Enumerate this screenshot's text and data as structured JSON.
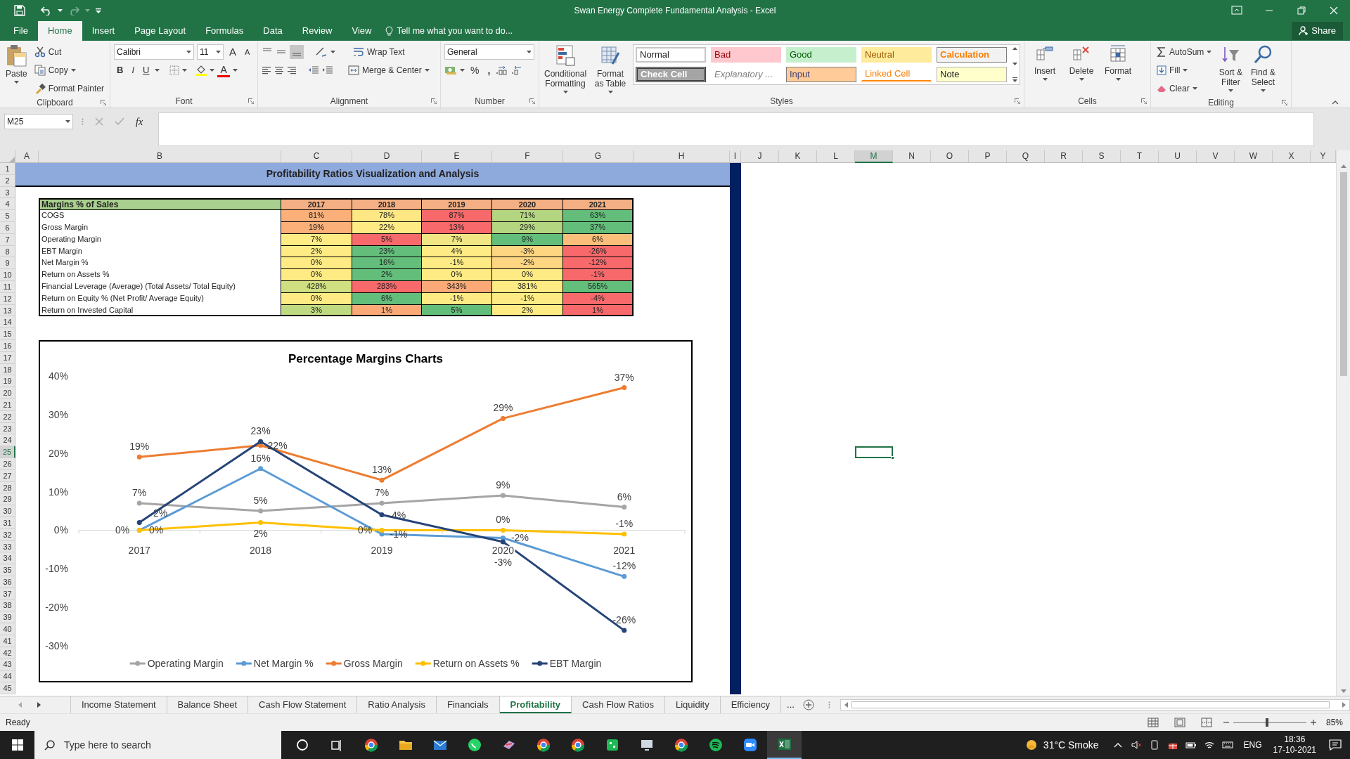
{
  "window": {
    "title": "Swan Energy Complete Fundamental Analysis - Excel"
  },
  "menu_tabs": [
    {
      "label": "File",
      "selected": false
    },
    {
      "label": "Home",
      "selected": true
    },
    {
      "label": "Insert",
      "selected": false
    },
    {
      "label": "Page Layout",
      "selected": false
    },
    {
      "label": "Formulas",
      "selected": false
    },
    {
      "label": "Data",
      "selected": false
    },
    {
      "label": "Review",
      "selected": false
    },
    {
      "label": "View",
      "selected": false
    }
  ],
  "tell_me": "Tell me what you want to do...",
  "share": "Share",
  "ribbon": {
    "clipboard": {
      "label": "Clipboard",
      "paste": "Paste",
      "cut": "Cut",
      "copy": "Copy",
      "format_painter": "Format Painter"
    },
    "font": {
      "label": "Font",
      "font_name": "Calibri",
      "font_size": "11",
      "grow_font": "A",
      "shrink_font": "A",
      "bold": "B",
      "italic": "I",
      "underline": "U",
      "font_color": "A"
    },
    "alignment": {
      "label": "Alignment",
      "wrap_text": "Wrap Text",
      "merge_center": "Merge & Center"
    },
    "number": {
      "label": "Number",
      "format": "General",
      "percent": "%",
      "comma": ","
    },
    "styles": {
      "label": "Styles",
      "conditional_formatting": "Conditional Formatting",
      "format_as_table": "Format as Table",
      "cell_styles": [
        {
          "label": "Normal",
          "kind": "normal"
        },
        {
          "label": "Bad",
          "kind": "bad"
        },
        {
          "label": "Good",
          "kind": "good"
        },
        {
          "label": "Neutral",
          "kind": "neutral"
        },
        {
          "label": "Calculation",
          "kind": "calculation"
        },
        {
          "label": "Check Cell",
          "kind": "check"
        },
        {
          "label": "Explanatory ...",
          "kind": "explanatory"
        },
        {
          "label": "Input",
          "kind": "input"
        },
        {
          "label": "Linked Cell",
          "kind": "linked"
        },
        {
          "label": "Note",
          "kind": "note"
        }
      ]
    },
    "cells": {
      "label": "Cells",
      "insert": "Insert",
      "delete": "Delete",
      "format": "Format"
    },
    "editing": {
      "label": "Editing",
      "autosum": "AutoSum",
      "fill": "Fill",
      "clear": "Clear",
      "sort_filter": "Sort & Filter",
      "find_select": "Find & Select"
    }
  },
  "formula_bar": {
    "name_box": "M25",
    "fx": "fx"
  },
  "columns": [
    {
      "label": "A",
      "selected": false
    },
    {
      "label": "B",
      "selected": false
    },
    {
      "label": "C",
      "selected": false
    },
    {
      "label": "D",
      "selected": false
    },
    {
      "label": "E",
      "selected": false
    },
    {
      "label": "F",
      "selected": false
    },
    {
      "label": "G",
      "selected": false
    },
    {
      "label": "H",
      "selected": false
    },
    {
      "label": "I",
      "selected": false
    },
    {
      "label": "J",
      "selected": false
    },
    {
      "label": "K",
      "selected": false
    },
    {
      "label": "L",
      "selected": false
    },
    {
      "label": "M",
      "selected": true
    },
    {
      "label": "N",
      "selected": false
    },
    {
      "label": "O",
      "selected": false
    },
    {
      "label": "P",
      "selected": false
    },
    {
      "label": "Q",
      "selected": false
    },
    {
      "label": "R",
      "selected": false
    },
    {
      "label": "S",
      "selected": false
    },
    {
      "label": "T",
      "selected": false
    },
    {
      "label": "U",
      "selected": false
    },
    {
      "label": "V",
      "selected": false
    },
    {
      "label": "W",
      "selected": false
    },
    {
      "label": "X",
      "selected": false
    },
    {
      "label": "Y",
      "selected": false
    }
  ],
  "rows": [
    {
      "label": "1",
      "selected": false
    },
    {
      "label": "2",
      "selected": false
    },
    {
      "label": "3",
      "selected": false
    },
    {
      "label": "4",
      "selected": false
    },
    {
      "label": "5",
      "selected": false
    },
    {
      "label": "6",
      "selected": false
    },
    {
      "label": "7",
      "selected": false
    },
    {
      "label": "8",
      "selected": false
    },
    {
      "label": "9",
      "selected": false
    },
    {
      "label": "10",
      "selected": false
    },
    {
      "label": "11",
      "selected": false
    },
    {
      "label": "12",
      "selected": false
    },
    {
      "label": "13",
      "selected": false
    },
    {
      "label": "14",
      "selected": false
    },
    {
      "label": "15",
      "selected": false
    },
    {
      "label": "16",
      "selected": false
    },
    {
      "label": "17",
      "selected": false
    },
    {
      "label": "18",
      "selected": false
    },
    {
      "label": "19",
      "selected": false
    },
    {
      "label": "20",
      "selected": false
    },
    {
      "label": "21",
      "selected": false
    },
    {
      "label": "22",
      "selected": false
    },
    {
      "label": "23",
      "selected": false
    },
    {
      "label": "24",
      "selected": false
    },
    {
      "label": "25",
      "selected": true
    },
    {
      "label": "26",
      "selected": false
    },
    {
      "label": "27",
      "selected": false
    },
    {
      "label": "28",
      "selected": false
    },
    {
      "label": "29",
      "selected": false
    },
    {
      "label": "30",
      "selected": false
    },
    {
      "label": "31",
      "selected": false
    },
    {
      "label": "32",
      "selected": false
    },
    {
      "label": "33",
      "selected": false
    },
    {
      "label": "34",
      "selected": false
    },
    {
      "label": "35",
      "selected": false
    },
    {
      "label": "36",
      "selected": false
    },
    {
      "label": "37",
      "selected": false
    },
    {
      "label": "38",
      "selected": false
    },
    {
      "label": "39",
      "selected": false
    },
    {
      "label": "40",
      "selected": false
    },
    {
      "label": "41",
      "selected": false
    },
    {
      "label": "42",
      "selected": false
    },
    {
      "label": "43",
      "selected": false
    },
    {
      "label": "44",
      "selected": false
    },
    {
      "label": "45",
      "selected": false
    }
  ],
  "sheet_title": "Profitability Ratios Visualization and Analysis",
  "table": {
    "columns": [
      {
        "text": "Margins % of Sales",
        "color": "#a9d08e"
      },
      {
        "text": "2017",
        "color": "#f4b084"
      },
      {
        "text": "2018",
        "color": "#f4b084"
      },
      {
        "text": "2019",
        "color": "#f4b084"
      },
      {
        "text": "2020",
        "color": "#f4b084"
      },
      {
        "text": "2021",
        "color": "#f4b084"
      }
    ],
    "rows": [
      {
        "cells": [
          {
            "text": "COGS"
          },
          {
            "text": "81%",
            "color": "#fbb07a"
          },
          {
            "text": "78%",
            "color": "#ffe883"
          },
          {
            "text": "87%",
            "color": "#f8696b"
          },
          {
            "text": "71%",
            "color": "#b5d681"
          },
          {
            "text": "63%",
            "color": "#63be7b"
          }
        ]
      },
      {
        "cells": [
          {
            "text": "Gross Margin"
          },
          {
            "text": "19%",
            "color": "#fbb07a"
          },
          {
            "text": "22%",
            "color": "#ffeb84"
          },
          {
            "text": "13%",
            "color": "#f8696b"
          },
          {
            "text": "29%",
            "color": "#b5d681"
          },
          {
            "text": "37%",
            "color": "#63be7b"
          }
        ]
      },
      {
        "cells": [
          {
            "text": "Operating Margin"
          },
          {
            "text": "7%",
            "color": "#ffeb84"
          },
          {
            "text": "5%",
            "color": "#f8696b"
          },
          {
            "text": "7%",
            "color": "#f0e784"
          },
          {
            "text": "9%",
            "color": "#63be7b"
          },
          {
            "text": "6%",
            "color": "#fcbf7b"
          }
        ]
      },
      {
        "cells": [
          {
            "text": "EBT Margin"
          },
          {
            "text": "2%",
            "color": "#ffeb84"
          },
          {
            "text": "23%",
            "color": "#63be7b"
          },
          {
            "text": "4%",
            "color": "#ffeb84"
          },
          {
            "text": "-3%",
            "color": "#fed580"
          },
          {
            "text": "-26%",
            "color": "#f8696b"
          }
        ]
      },
      {
        "cells": [
          {
            "text": "Net Margin %"
          },
          {
            "text": "0%",
            "color": "#ffeb84"
          },
          {
            "text": "16%",
            "color": "#63be7b"
          },
          {
            "text": "-1%",
            "color": "#ffeb84"
          },
          {
            "text": "-2%",
            "color": "#fed580"
          },
          {
            "text": "-12%",
            "color": "#f8696b"
          }
        ]
      },
      {
        "cells": [
          {
            "text": "Return on Assets %"
          },
          {
            "text": "0%",
            "color": "#ffeb84"
          },
          {
            "text": "2%",
            "color": "#63be7b"
          },
          {
            "text": "0%",
            "color": "#ffeb84"
          },
          {
            "text": "0%",
            "color": "#ffeb84"
          },
          {
            "text": "-1%",
            "color": "#f8696b"
          }
        ]
      },
      {
        "cells": [
          {
            "text": "Financial Leverage (Average) (Total Assets/ Total Equity)"
          },
          {
            "text": "428%",
            "color": "#d0df82"
          },
          {
            "text": "283%",
            "color": "#f8696b"
          },
          {
            "text": "343%",
            "color": "#fbaa77"
          },
          {
            "text": "381%",
            "color": "#ffeb84"
          },
          {
            "text": "565%",
            "color": "#63be7b"
          }
        ]
      },
      {
        "cells": [
          {
            "text": "Return on Equity %  (Net Profit/ Average Equity)"
          },
          {
            "text": "0%",
            "color": "#ffeb84"
          },
          {
            "text": "6%",
            "color": "#63be7b"
          },
          {
            "text": "-1%",
            "color": "#ffeb84"
          },
          {
            "text": "-1%",
            "color": "#ffeb84"
          },
          {
            "text": "-4%",
            "color": "#f8696b"
          }
        ]
      },
      {
        "cells": [
          {
            "text": "Return on Invested Capital"
          },
          {
            "text": "3%",
            "color": "#c0da81"
          },
          {
            "text": "1%",
            "color": "#fbaa77"
          },
          {
            "text": "5%",
            "color": "#63be7b"
          },
          {
            "text": "2%",
            "color": "#ffeb84"
          },
          {
            "text": "1%",
            "color": "#f8696b"
          }
        ]
      }
    ]
  },
  "chart": {
    "chart_data": {
      "type": "line",
      "title": "Percentage Margins Charts",
      "categories": [
        "2017",
        "2018",
        "2019",
        "2020",
        "2021"
      ],
      "ylim": [
        -30,
        40
      ],
      "yticks": [
        {
          "value": 40,
          "label": "40%"
        },
        {
          "value": 30,
          "label": "30%"
        },
        {
          "value": 20,
          "label": "20%"
        },
        {
          "value": 10,
          "label": "10%"
        },
        {
          "value": 0,
          "label": "0%"
        },
        {
          "value": -10,
          "label": "-10%"
        },
        {
          "value": -20,
          "label": "-20%"
        },
        {
          "value": -30,
          "label": "-30%"
        }
      ],
      "data_labels": true,
      "legend": "bottom",
      "series": [
        {
          "name": "Operating Margin",
          "color": "#a5a5a5",
          "marker": "circle",
          "values": [
            7,
            5,
            7,
            9,
            6
          ],
          "value_labels": [
            "7%",
            "5%",
            "7%",
            "9%",
            "6%"
          ]
        },
        {
          "name": "Net Margin %",
          "color": "#5b9bd5",
          "marker": "circle",
          "values": [
            0,
            16,
            -1,
            -2,
            -12
          ],
          "value_labels": [
            "0%",
            "16%",
            "-1%",
            "-2%",
            "-12%"
          ]
        },
        {
          "name": "Gross Margin",
          "color": "#ed7d31",
          "marker": "circle",
          "values": [
            19,
            22,
            13,
            29,
            37
          ],
          "value_labels": [
            "19%",
            "22%",
            "13%",
            "29%",
            "37%"
          ]
        },
        {
          "name": "Return on Assets %",
          "color": "#ffc000",
          "marker": "circle",
          "values": [
            0,
            2,
            0,
            0,
            -1
          ],
          "value_labels": [
            "0%",
            "2%",
            "0%",
            "0%",
            "-1%"
          ]
        },
        {
          "name": "EBT Margin",
          "color": "#264478",
          "marker": "circle",
          "values": [
            2,
            23,
            4,
            -3,
            -26
          ],
          "value_labels": [
            "2%",
            "23%",
            "4%",
            "-3%",
            "-26%"
          ]
        }
      ]
    }
  },
  "sheet_tabs": [
    {
      "label": "Income Statement",
      "selected": false
    },
    {
      "label": "Balance Sheet",
      "selected": false
    },
    {
      "label": "Cash Flow Statement",
      "selected": false
    },
    {
      "label": "Ratio Analysis",
      "selected": false
    },
    {
      "label": "Financials",
      "selected": false
    },
    {
      "label": "Profitability",
      "selected": true
    },
    {
      "label": "Cash Flow Ratios",
      "selected": false
    },
    {
      "label": "Liquidity",
      "selected": false
    },
    {
      "label": "Efficiency",
      "selected": false
    }
  ],
  "more_tabs": "...",
  "status_bar": {
    "text": "Ready",
    "zoom": "85%",
    "zoom_slider": {
      "level": 0.44
    }
  },
  "taskbar": {
    "search": {
      "placeholder": "Type here to search"
    },
    "weather": "31°C Smoke",
    "language": "ENG",
    "time": "18:36",
    "date": "17-10-2021"
  }
}
